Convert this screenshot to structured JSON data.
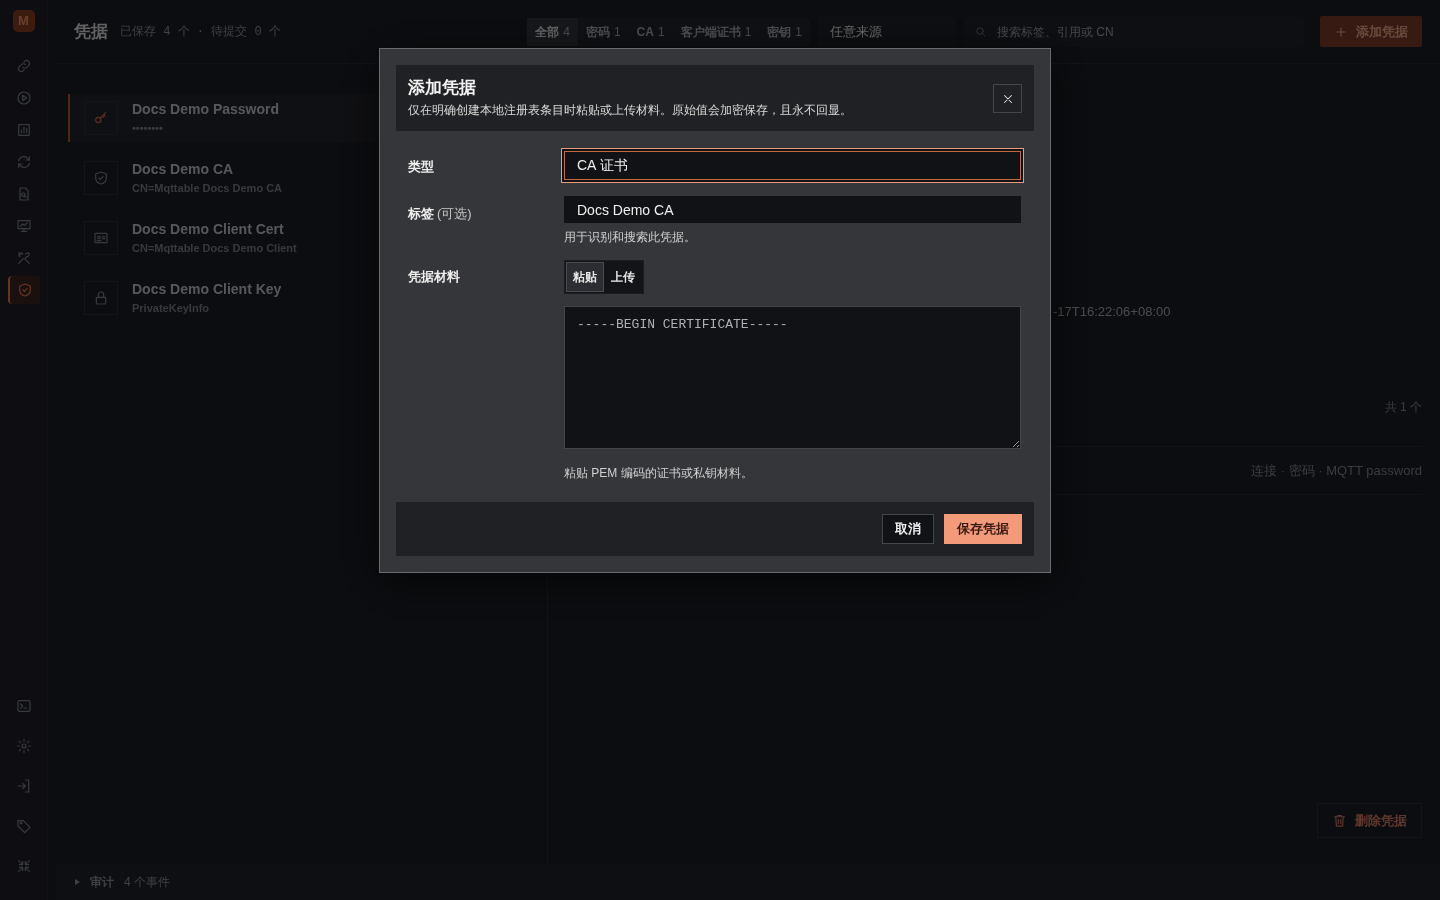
{
  "sidebar": {
    "logo": "M",
    "items": [
      {
        "selected": false
      },
      {
        "selected": false
      },
      {
        "selected": false
      },
      {
        "selected": false
      },
      {
        "selected": false
      },
      {
        "selected": false
      },
      {
        "selected": false
      },
      {
        "selected": true
      }
    ],
    "bottom_items": [
      {
        "selected": false
      },
      {
        "selected": false
      },
      {
        "selected": false
      },
      {
        "selected": false
      },
      {
        "selected": false
      }
    ]
  },
  "header": {
    "title": "凭据",
    "stats": "已保存 4 个 · 待提交 0 个",
    "filters": [
      {
        "label": "全部",
        "count": "4",
        "selected": true
      },
      {
        "label": "密码",
        "count": "1",
        "selected": false
      },
      {
        "label": "CA",
        "count": "1",
        "selected": false
      },
      {
        "label": "客户端证书",
        "count": "1",
        "selected": false
      },
      {
        "label": "密钥",
        "count": "1",
        "selected": false
      }
    ],
    "source_select": {
      "value": "任意来源"
    },
    "search": {
      "placeholder": "搜索标签、引用或 CN"
    },
    "add_button": "添加凭据"
  },
  "credentials": [
    {
      "kind": "password",
      "name": "Docs Demo Password",
      "detail": "••••••••",
      "selected": true
    },
    {
      "kind": "ca",
      "name": "Docs Demo CA",
      "detail": "CN=Mqttable Docs Demo CA",
      "selected": false
    },
    {
      "kind": "cert",
      "name": "Docs Demo Client Cert",
      "detail": "CN=Mqttable Docs Demo Client",
      "selected": false
    },
    {
      "kind": "key",
      "name": "Docs Demo Client Key",
      "detail": "PrivateKeyInfo",
      "selected": false
    }
  ],
  "detail": {
    "timestamp": "-17T16:22:06+08:00",
    "usage_count": "共 1 个",
    "usage": "连接 · 密码 · MQTT password",
    "delete_button": "删除凭据"
  },
  "audit": {
    "expanded": false,
    "label": "审计",
    "count": "4 个事件"
  },
  "modal": {
    "title": "添加凭据",
    "description": "仅在明确创建本地注册表条目时粘贴或上传材料。原始值会加密保存，且永不回显。",
    "fields": [
      {
        "kind": "select",
        "label": "类型",
        "value": "CA 证书",
        "focused": true
      },
      {
        "kind": "text",
        "label": "标签",
        "optional": "(可选)",
        "value": "Docs Demo CA",
        "hint": "用于识别和搜索此凭据。",
        "focused": false
      },
      {
        "kind": "material",
        "label": "凭据材料",
        "modes": [
          {
            "label": "粘贴",
            "selected": true
          },
          {
            "label": "上传",
            "selected": false
          }
        ],
        "value": "-----BEGIN CERTIFICATE-----",
        "hint": "粘贴 PEM 编码的证书或私钥材料。"
      }
    ],
    "cancel_button": "取消",
    "save_button": "保存凭据"
  }
}
